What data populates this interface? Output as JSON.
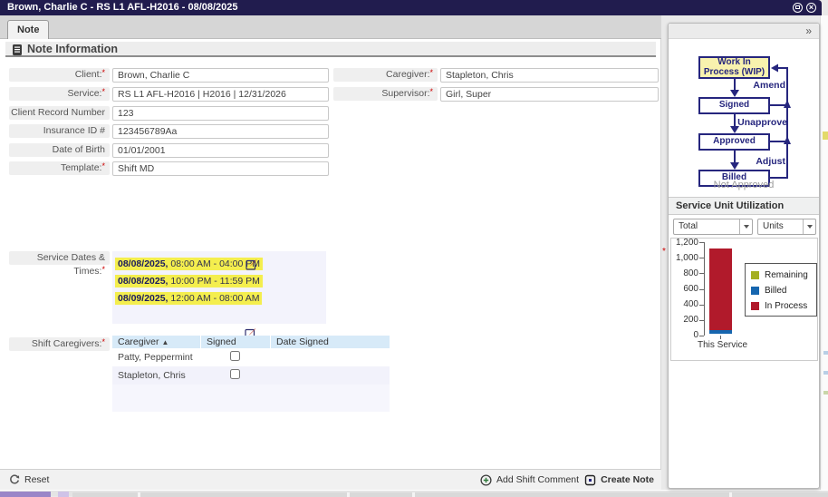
{
  "window": {
    "title": "Brown, Charlie C - RS L1 AFL-H2016 - 08/08/2025"
  },
  "ui": {
    "required_marker": "*",
    "collapse_chevrons": "»",
    "sort_asc": "▲",
    "close_glyph": "×"
  },
  "tab": {
    "label": "Note"
  },
  "section": {
    "title": "Note Information"
  },
  "form": {
    "left": [
      {
        "label": "Client:",
        "required": true,
        "value": "Brown, Charlie C"
      },
      {
        "label": "Service:",
        "required": true,
        "value": "RS L1 AFL-H2016 | H2016 | 12/31/2026"
      },
      {
        "label": "Client Record Number",
        "required": false,
        "value": "123"
      },
      {
        "label": "Insurance ID #",
        "required": false,
        "value": "123456789Aa"
      },
      {
        "label": "Date of Birth",
        "required": false,
        "value": "01/01/2001"
      },
      {
        "label": "Template:",
        "required": true,
        "value": "Shift MD"
      }
    ],
    "right": [
      {
        "label": "Caregiver:",
        "required": true,
        "value": "Stapleton, Chris"
      },
      {
        "label": "Supervisor:",
        "required": true,
        "value": "Girl, Super"
      }
    ]
  },
  "service_dates": {
    "label": "Service Dates & Times:",
    "highlight_color": "#f4ee4e",
    "rows": [
      {
        "date": "08/08/2025,",
        "time": "08:00 AM - 04:00 PM"
      },
      {
        "date": "08/08/2025,",
        "time": "10:00 PM - 11:59 PM"
      },
      {
        "date": "08/09/2025,",
        "time": "12:00 AM - 08:00 AM"
      }
    ]
  },
  "shift_caregivers": {
    "label": "Shift Caregivers:",
    "columns": [
      "Caregiver",
      "Signed",
      "Date Signed"
    ],
    "rows": [
      {
        "name": "Patty, Peppermint",
        "signed": false,
        "date_signed": ""
      },
      {
        "name": "Stapleton, Chris",
        "signed": false,
        "date_signed": ""
      }
    ]
  },
  "footer": {
    "reset": "Reset",
    "add_shift_comment": "Add Shift Comment",
    "create_note": "Create Note"
  },
  "workflow": {
    "accent": "#26267e",
    "boxes": [
      {
        "label": "Work In Process (WIP)",
        "fill": "#f8f2ae"
      },
      {
        "label": "Signed",
        "fill": "#ffffff"
      },
      {
        "label": "Approved",
        "fill": "#ffffff"
      },
      {
        "label": "Billed",
        "fill": "#ffffff"
      }
    ],
    "edges": [
      "Amend",
      "Unapprove",
      "Adjust"
    ],
    "status_note": "Not Approved"
  },
  "utilization": {
    "title": "Service Unit Utilization",
    "filters": [
      {
        "value": "Total"
      },
      {
        "value": "Units"
      }
    ]
  },
  "chart_data": {
    "type": "bar",
    "stacked": true,
    "title": "Service Unit Utilization",
    "categories": [
      "This Service"
    ],
    "series": [
      {
        "name": "Remaining",
        "value": 0,
        "color": "#a4af22"
      },
      {
        "name": "Billed",
        "value": 50,
        "color": "#1666af"
      },
      {
        "name": "In Process",
        "value": 1050,
        "color": "#b11a2b"
      }
    ],
    "stack_order_top_to_bottom": [
      "Remaining",
      "In Process",
      "Billed"
    ],
    "ylim": [
      0,
      1200
    ],
    "yticks": [
      0,
      200,
      400,
      600,
      800,
      1000,
      1200
    ],
    "ytick_labels": [
      "0",
      "200",
      "400",
      "600",
      "800",
      "1,000",
      "1,200"
    ],
    "xlabel": "",
    "ylabel": "",
    "legend_position": "right",
    "grid": false
  }
}
